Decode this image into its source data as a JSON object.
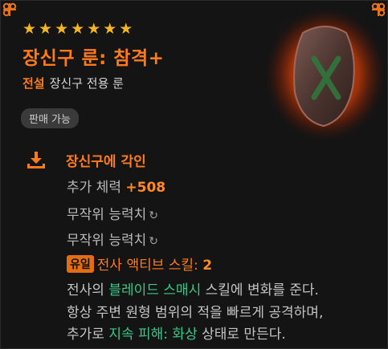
{
  "item": {
    "stars": 7,
    "name": "장신구 룬: 참격+",
    "rarity": "전설",
    "subtype": "장신구 전용 룬",
    "badge": "판매 가능"
  },
  "engrave": {
    "title": "장신구에 각인",
    "stat_label": "추가 체력 ",
    "stat_value": "+508",
    "random_stats": [
      "무작위 능력치",
      "무작위 능력치"
    ],
    "unique_tag": "유일",
    "skill_label": "전사 액티브 스킬: ",
    "skill_value": "2"
  },
  "description": {
    "line1_a": "전사의 ",
    "line1_skill": "블레이드 스매시",
    "line1_b": " 스킬에 변화를 준다.",
    "line2": "항상 주변 원형 범위의 적을 빠르게 공격하며,",
    "line3_a": "추가로 ",
    "line3_effect": "지속 피해: 화상",
    "line3_b": " 상태로 만든다."
  },
  "colors": {
    "accent": "#ff7a1a",
    "star": "#f5b423",
    "effect_green": "#39c988",
    "background": "#141414"
  },
  "icons": {
    "star": "star-icon",
    "engrave": "engrave-download-icon",
    "reroll": "reroll-icon",
    "corner": "corner-knot-icon",
    "rune": "rune-stone-icon"
  }
}
